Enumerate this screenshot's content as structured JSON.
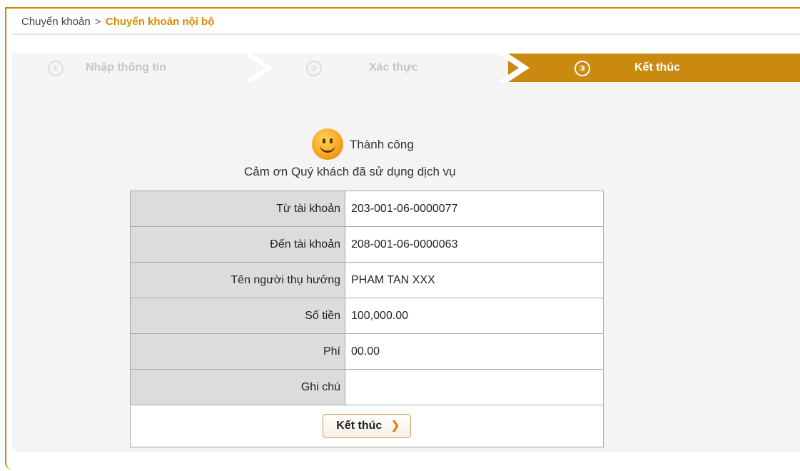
{
  "breadcrumb": {
    "parent": "Chuyển khoản",
    "separator": ">",
    "current": "Chuyển khoản nội bộ"
  },
  "stepper": {
    "steps": [
      {
        "num": "①",
        "label": "Nhập thông tin",
        "state": "done"
      },
      {
        "num": "②",
        "label": "Xác thực",
        "state": "done"
      },
      {
        "num": "③",
        "label": "Kết thúc",
        "state": "active"
      }
    ]
  },
  "result": {
    "icon": "smiley-icon",
    "title": "Thành công",
    "message": "Cảm ơn Quý khách đã sử dụng dịch vụ"
  },
  "details": {
    "rows": [
      {
        "label": "Từ tài khoản",
        "value": "203-001-06-0000077"
      },
      {
        "label": "Đến tài khoản",
        "value": "208-001-06-0000063"
      },
      {
        "label": "Tên người thụ hưởng",
        "value": "PHAM TAN XXX"
      },
      {
        "label": "Số tiền",
        "value": "100,000.00"
      },
      {
        "label": "Phí",
        "value": "00.00"
      },
      {
        "label": "Ghi chú",
        "value": ""
      }
    ]
  },
  "actions": {
    "finish_label": "Kết thúc",
    "finish_arrow": "❯"
  },
  "colors": {
    "accent": "#c98a0f",
    "breadcrumb_current": "#d98c00",
    "label_cell_bg": "#dcdcdc"
  }
}
